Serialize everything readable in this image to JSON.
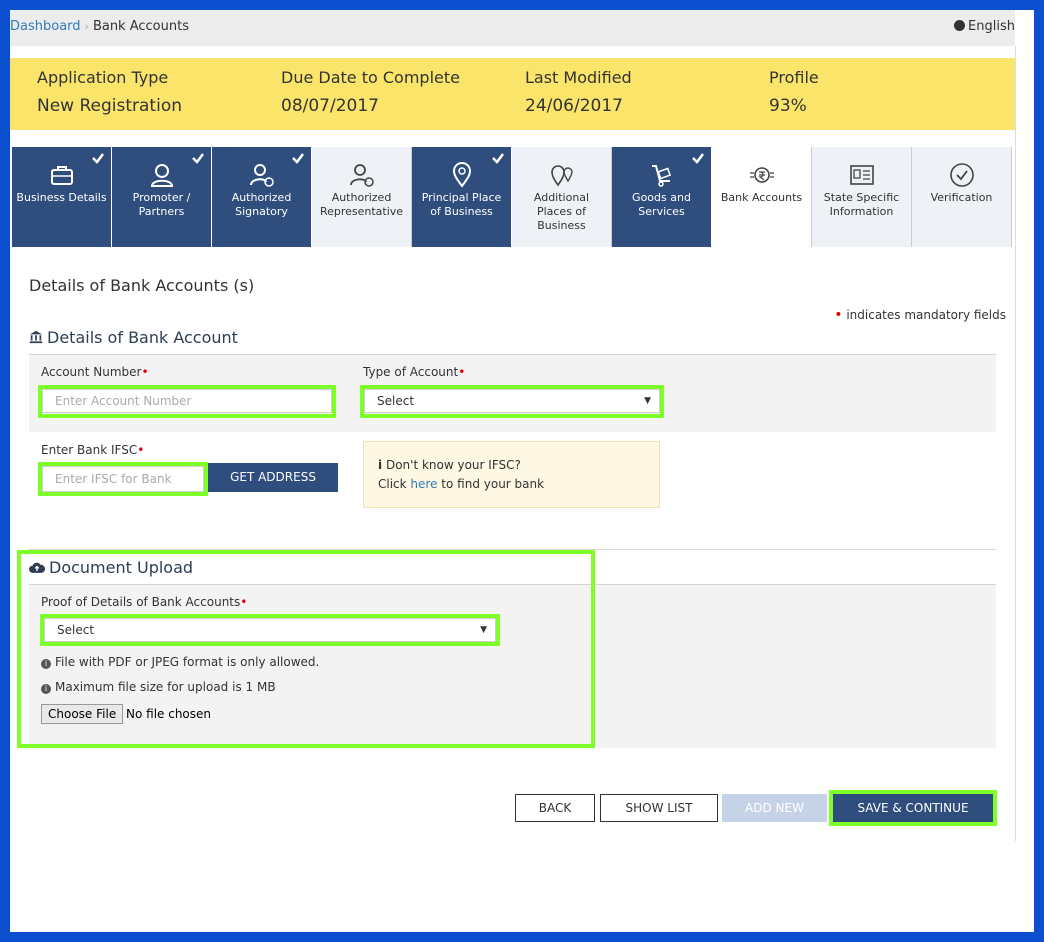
{
  "breadcrumb": {
    "home": "Dashboard",
    "current": "Bank Accounts"
  },
  "language": "English",
  "info": [
    {
      "label": "Application Type",
      "value": "New Registration"
    },
    {
      "label": "Due Date to Complete",
      "value": "08/07/2017"
    },
    {
      "label": "Last Modified",
      "value": "24/06/2017"
    },
    {
      "label": "Profile",
      "value": "93%"
    }
  ],
  "steps": [
    {
      "label": "Business Details",
      "icon": "briefcase-icon",
      "state": "done"
    },
    {
      "label": "Promoter / Partners",
      "icon": "person-icon",
      "state": "done"
    },
    {
      "label": "Authorized Signatory",
      "icon": "signatory-icon",
      "state": "done"
    },
    {
      "label": "Authorized Representative",
      "icon": "representative-icon",
      "state": "pending"
    },
    {
      "label": "Principal Place of Business",
      "icon": "location-pin-icon",
      "state": "done"
    },
    {
      "label": "Additional Places of Business",
      "icon": "multi-location-icon",
      "state": "pending"
    },
    {
      "label": "Goods and Services",
      "icon": "cart-icon",
      "state": "done"
    },
    {
      "label": "Bank Accounts",
      "icon": "rupee-icon",
      "state": "active"
    },
    {
      "label": "State Specific Information",
      "icon": "id-card-icon",
      "state": "pending"
    },
    {
      "label": "Verification",
      "icon": "check-circle-icon",
      "state": "pending"
    }
  ],
  "section_title": "Details of Bank Accounts (s)",
  "mandatory_note": "indicates mandatory fields",
  "bank_section_title": "Details of Bank Account",
  "account_number": {
    "label": "Account Number",
    "placeholder": "Enter Account Number"
  },
  "account_type": {
    "label": "Type of Account",
    "value": "Select"
  },
  "ifsc": {
    "label": "Enter Bank IFSC",
    "placeholder": "Enter IFSC for Bank",
    "button": "GET ADDRESS"
  },
  "ifsc_tip": {
    "line1": "Don't know your IFSC?",
    "click": "Click",
    "link": "here",
    "rest": "to find your bank"
  },
  "upload": {
    "title": "Document Upload",
    "proof_label": "Proof of Details of Bank Accounts",
    "proof_value": "Select",
    "note1": "File with PDF or JPEG format is only allowed.",
    "note2": "Maximum file size for upload is 1 MB",
    "choose_file": "Choose File",
    "no_file": "No file chosen"
  },
  "actions": {
    "back": "BACK",
    "show_list": "SHOW LIST",
    "add_new": "ADD NEW",
    "save": "SAVE & CONTINUE"
  },
  "colors": {
    "navy": "#2f4e7e",
    "highlight": "#7fff2a",
    "info_bar": "#fbe46a",
    "frame": "#0b4fcf"
  }
}
